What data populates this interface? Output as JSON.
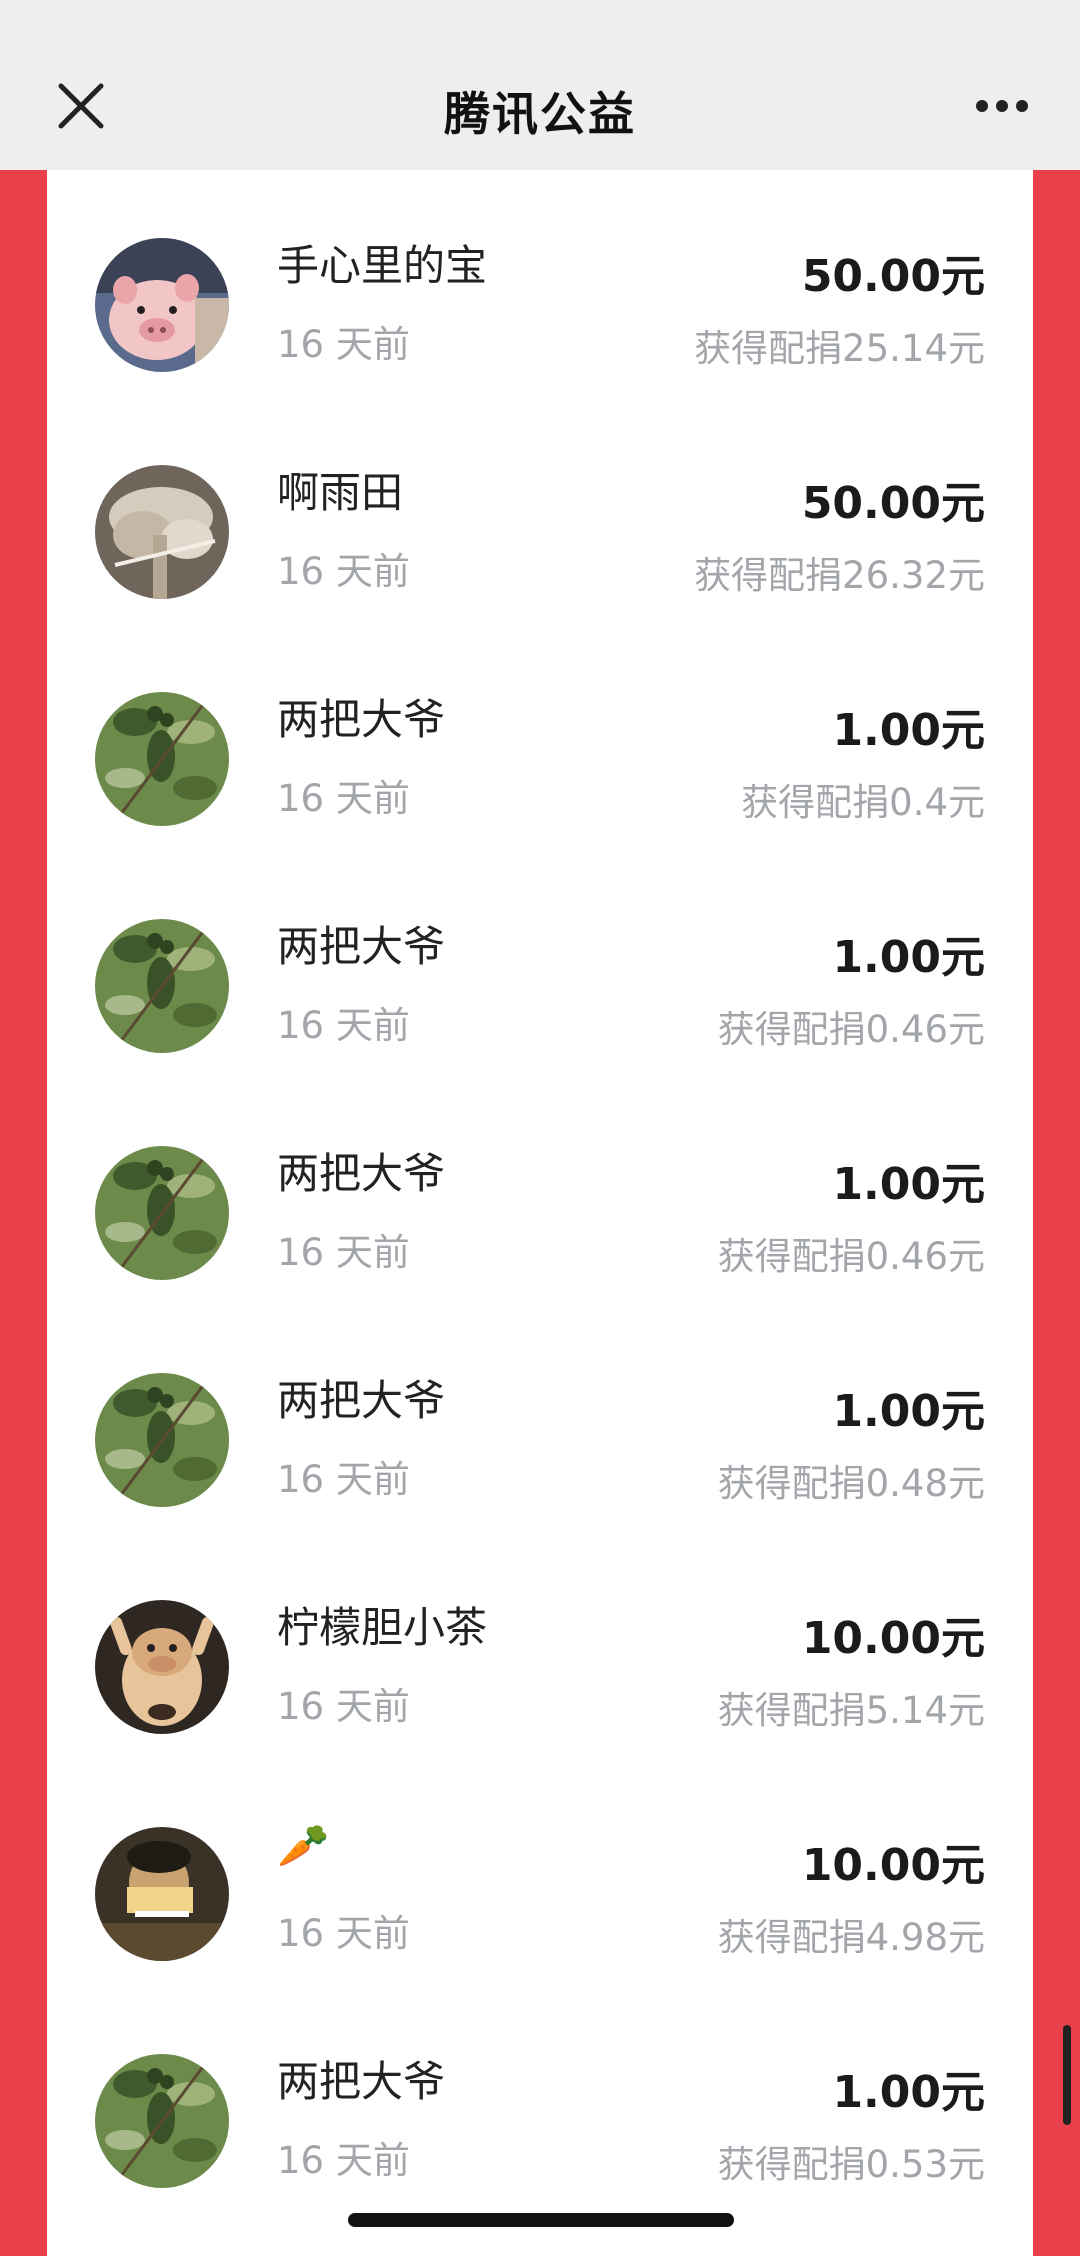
{
  "navbar": {
    "title": "腾讯公益",
    "close_icon": "close-icon",
    "more_icon": "more-dots-icon"
  },
  "colors": {
    "page_background": "#e8414c",
    "navbar_background": "#eeeeee",
    "amount_text": "#1b1b1b",
    "secondary_text": "#a2a6aa"
  },
  "donations": [
    {
      "name": "手心里的宝",
      "time": "16 天前",
      "amount": "50.00元",
      "match": "获得配捐25.14元",
      "avatar": "pig-avatar"
    },
    {
      "name": "啊雨田",
      "time": "16 天前",
      "amount": "50.00元",
      "match": "获得配捐26.32元",
      "avatar": "mushroom-avatar"
    },
    {
      "name": "两把大爷",
      "time": "16 天前",
      "amount": "1.00元",
      "match": "获得配捐0.4元",
      "avatar": "leaves-avatar"
    },
    {
      "name": "两把大爷",
      "time": "16 天前",
      "amount": "1.00元",
      "match": "获得配捐0.46元",
      "avatar": "leaves-avatar"
    },
    {
      "name": "两把大爷",
      "time": "16 天前",
      "amount": "1.00元",
      "match": "获得配捐0.46元",
      "avatar": "leaves-avatar"
    },
    {
      "name": "两把大爷",
      "time": "16 天前",
      "amount": "1.00元",
      "match": "获得配捐0.48元",
      "avatar": "leaves-avatar"
    },
    {
      "name": "柠檬胆小茶",
      "time": "16 天前",
      "amount": "10.00元",
      "match": "获得配捐5.14元",
      "avatar": "hippo-avatar"
    },
    {
      "name": "🥕",
      "time": "16 天前",
      "amount": "10.00元",
      "match": "获得配捐4.98元",
      "avatar": "person-photo-avatar"
    },
    {
      "name": "两把大爷",
      "time": "16 天前",
      "amount": "1.00元",
      "match": "获得配捐0.53元",
      "avatar": "leaves-avatar"
    }
  ]
}
